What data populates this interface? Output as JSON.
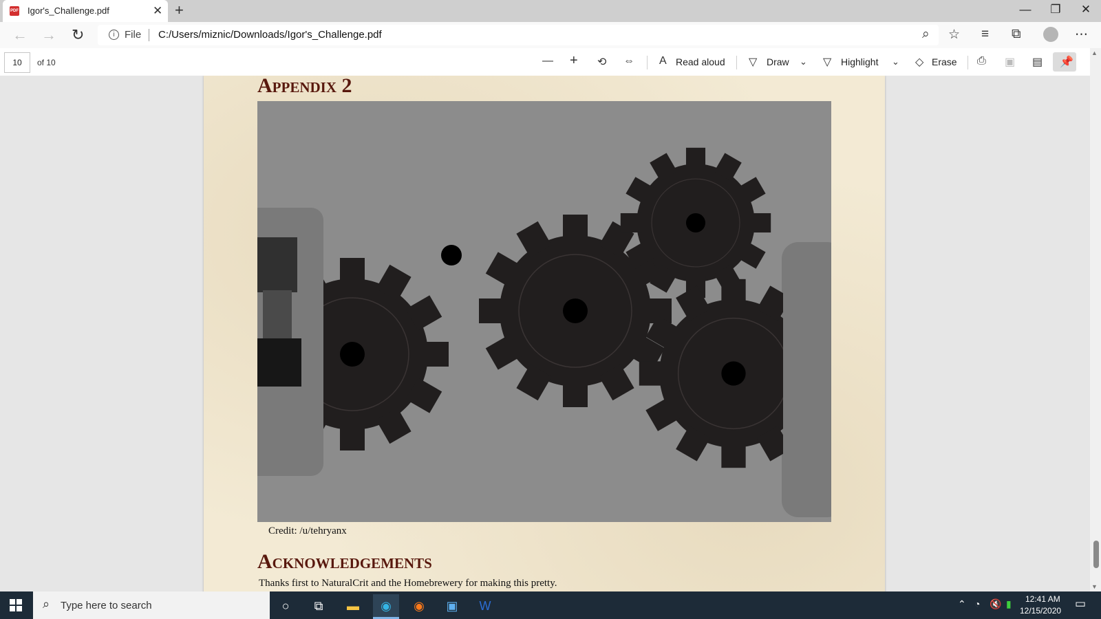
{
  "browser": {
    "tab_title": "Igor's_Challenge.pdf",
    "tab_icon": "pdf-icon",
    "new_tab": "+",
    "address_prefix": "File",
    "url": "C:/Users/miznic/Downloads/Igor's_Challenge.pdf"
  },
  "pdf_toolbar": {
    "page_number": "10",
    "page_total": "of 10",
    "read_aloud": "Read aloud",
    "draw": "Draw",
    "highlight": "Highlight",
    "erase": "Erase"
  },
  "document": {
    "appendix_heading": "Appendix 2",
    "image_caption": "Credit: /u/tehryanx",
    "ack_heading": "Acknowledgements",
    "ack_text": "Thanks first to NaturalCrit and the Homebrewery for making this pretty."
  },
  "taskbar": {
    "search_placeholder": "Type here to search",
    "time": "12:41 AM",
    "date": "12/15/2020"
  },
  "colors": {
    "heading": "#58180d",
    "parchment": "#f3ead4",
    "taskbar": "#1d2b38",
    "gear": "#211e1e",
    "figure_bg": "#8c8c8c"
  }
}
